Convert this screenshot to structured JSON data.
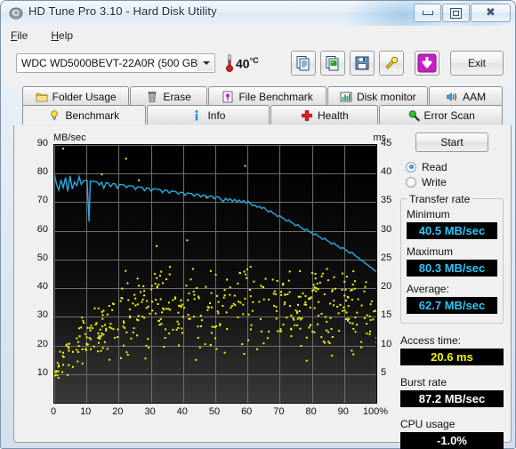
{
  "window": {
    "title": "HD Tune Pro 3.10 - Hard Disk Utility",
    "icon": "hdd-icon",
    "controls": {
      "minimize": "minimize-icon",
      "maximize": "maximize-icon",
      "close": "close-icon"
    }
  },
  "menu": {
    "items": [
      {
        "label": "File",
        "mnemonic": "F"
      },
      {
        "label": "Help",
        "mnemonic": "H"
      }
    ]
  },
  "toolbar": {
    "drive": {
      "selected": "WDC WD5000BEVT-22A0R (500 GB)",
      "options": [
        "WDC WD5000BEVT-22A0R (500 GB)"
      ]
    },
    "temperature": {
      "value": "40",
      "unit": "°C",
      "icon": "thermometer-icon"
    },
    "buttons": [
      {
        "name": "copy-text-button",
        "icon": "copy-document-icon",
        "label": ""
      },
      {
        "name": "copy-image-button",
        "icon": "copy-image-icon",
        "label": ""
      },
      {
        "name": "save-button",
        "icon": "floppy-disk-icon",
        "label": ""
      },
      {
        "name": "options-button",
        "icon": "wrench-icon",
        "label": ""
      },
      {
        "name": "download-button",
        "icon": "down-arrow-icon",
        "label": ""
      }
    ],
    "exit_label": "Exit"
  },
  "tabs": {
    "row1": [
      {
        "label": "Folder Usage",
        "icon": "folder-icon",
        "active": false
      },
      {
        "label": "Erase",
        "icon": "trash-icon",
        "active": false
      },
      {
        "label": "File Benchmark",
        "icon": "file-benchmark-icon",
        "active": false
      },
      {
        "label": "Disk monitor",
        "icon": "bar-chart-icon",
        "active": false
      },
      {
        "label": "AAM",
        "icon": "speaker-icon",
        "active": false
      }
    ],
    "row2": [
      {
        "label": "Benchmark",
        "icon": "lightbulb-icon",
        "active": true
      },
      {
        "label": "Info",
        "icon": "info-icon",
        "active": false
      },
      {
        "label": "Health",
        "icon": "red-cross-icon",
        "active": false
      },
      {
        "label": "Error Scan",
        "icon": "magnifier-icon",
        "active": false
      }
    ]
  },
  "side": {
    "start_label": "Start",
    "mode": {
      "options": [
        {
          "label": "Read",
          "selected": true
        },
        {
          "label": "Write",
          "selected": false
        }
      ]
    },
    "transfer_rate": {
      "title": "Transfer rate",
      "minimum_label": "Minimum",
      "minimum_value": "40.5 MB/sec",
      "maximum_label": "Maximum",
      "maximum_value": "80.3 MB/sec",
      "average_label": "Average:",
      "average_value": "62.7 MB/sec"
    },
    "access_time_label": "Access time:",
    "access_time_value": "20.6 ms",
    "burst_rate_label": "Burst rate",
    "burst_rate_value": "87.2 MB/sec",
    "cpu_usage_label": "CPU usage",
    "cpu_usage_value": "-1.0%"
  },
  "colors": {
    "transfer_line": "#29a9e0",
    "access_dots": "#f5f500",
    "plot_bg": "#000000",
    "grid": "#6e6e6e",
    "stat_cyan": "#2ec5f6",
    "stat_yellow": "#f5f500",
    "stat_white": "#ffffff"
  },
  "chart_data": {
    "type": "line",
    "title": "",
    "xlabel": "",
    "ylabel": "MB/sec",
    "y2label": "ms",
    "xlim": [
      0,
      100
    ],
    "ylim": [
      0,
      90
    ],
    "y2lim": [
      0,
      45
    ],
    "grid": true,
    "legend": "none",
    "xticks": [
      "0",
      "10",
      "20",
      "30",
      "40",
      "50",
      "60",
      "70",
      "80",
      "90",
      "100%"
    ],
    "xtick_values": [
      0,
      10,
      20,
      30,
      40,
      50,
      60,
      70,
      80,
      90,
      100
    ],
    "yticks": [
      10,
      20,
      30,
      40,
      50,
      60,
      70,
      80,
      90
    ],
    "y2ticks": [
      5,
      10,
      15,
      20,
      25,
      30,
      35,
      40,
      45
    ],
    "series": [
      {
        "name": "Transfer rate",
        "axis": "left",
        "units": "MB/sec",
        "color": "#29a9e0",
        "x": [
          0,
          0.7,
          1.4,
          2.1,
          2.8,
          3.5,
          4.2,
          4.9,
          5.6,
          6.3,
          7,
          7.7,
          8.4,
          9.1,
          9.8,
          10.2,
          10.5,
          10.8,
          11.2,
          11.9,
          12.6,
          13.3,
          14,
          14.7,
          15.4,
          16.1,
          16.8,
          17.5,
          18.2,
          18.9,
          19.6,
          20.3,
          21,
          21.7,
          22.4,
          23.1,
          23.8,
          24.5,
          25.2,
          25.9,
          26.6,
          27.3,
          28,
          28.7,
          29.4,
          30.1,
          30.8,
          31.5,
          32.2,
          32.9,
          33.6,
          34.3,
          35,
          35.7,
          36.4,
          37.1,
          37.8,
          38.5,
          39.2,
          39.9,
          40.6,
          41.3,
          42,
          42.7,
          43.4,
          44.1,
          44.8,
          45.5,
          46.2,
          46.9,
          47.6,
          48.3,
          49,
          49.7,
          50.4,
          51.1,
          51.8,
          52.5,
          53.2,
          53.9,
          54.6,
          55.3,
          56,
          56.7,
          57.4,
          58.1,
          58.8,
          59.5,
          60.2,
          60.9,
          61.6,
          62.3,
          63,
          63.7,
          64.4,
          65.1,
          65.8,
          66.5,
          67.2,
          67.9,
          68.6,
          69.3,
          70,
          70.7,
          71.4,
          72.1,
          72.8,
          73.5,
          74.2,
          74.9,
          75.6,
          76.3,
          77,
          77.7,
          78.4,
          79.1,
          79.8,
          80.5,
          81.2,
          81.9,
          82.6,
          83.3,
          84,
          84.7,
          85.4,
          86.1,
          86.8,
          87.5,
          88.2,
          88.9,
          89.6,
          90.3,
          91,
          91.7,
          92.4,
          93.1,
          93.8,
          94.5,
          95.2,
          95.9,
          96.6,
          97.3,
          98,
          98.7,
          99.4,
          100
        ],
        "y": [
          80.0,
          76.4,
          74.2,
          77.8,
          75.1,
          78.6,
          73.8,
          79.2,
          74.6,
          77.1,
          75.8,
          78.9,
          76.2,
          77.5,
          77.6,
          77.6,
          70.5,
          63.2,
          77.4,
          77.3,
          77.2,
          77.1,
          76.0,
          77.0,
          74.9,
          76.8,
          76.7,
          75.4,
          76.5,
          76.4,
          74.8,
          76.2,
          76.1,
          76.0,
          75.1,
          75.8,
          75.7,
          75.6,
          74.4,
          75.4,
          75.3,
          75.2,
          74.0,
          75.0,
          74.9,
          73.9,
          74.7,
          74.6,
          74.5,
          74.4,
          73.3,
          74.2,
          74.1,
          73.2,
          73.9,
          73.8,
          73.7,
          72.8,
          73.5,
          73.4,
          72.4,
          73.2,
          73.1,
          73.0,
          72.1,
          72.8,
          72.7,
          71.8,
          72.5,
          72.4,
          71.5,
          72.2,
          72.1,
          71.2,
          71.9,
          71.8,
          70.9,
          70.2,
          71.4,
          70.6,
          71.2,
          70.3,
          71.0,
          70.1,
          70.8,
          69.9,
          70.6,
          69.7,
          70.4,
          69.5,
          68.8,
          69.0,
          68.2,
          68.6,
          67.8,
          68.2,
          67.4,
          66.6,
          67.0,
          66.2,
          65.8,
          65.0,
          65.4,
          64.6,
          64.2,
          63.4,
          63.8,
          63.0,
          62.6,
          61.8,
          62.2,
          61.4,
          61.0,
          60.2,
          60.6,
          59.8,
          59.4,
          58.6,
          59.0,
          58.2,
          57.8,
          57.0,
          57.4,
          56.6,
          56.2,
          55.4,
          55.8,
          55.0,
          54.6,
          53.8,
          54.2,
          53.4,
          53.0,
          52.2,
          52.6,
          51.8,
          51.0,
          50.6,
          49.8,
          49.4,
          48.6,
          48.2,
          47.4,
          47.0,
          46.2,
          45.8,
          45.0,
          44.0,
          43.0,
          42.4,
          41.8
        ]
      },
      {
        "name": "Access time",
        "axis": "right",
        "units": "ms",
        "color": "#f5f500",
        "type": "scatter",
        "point_count": 470,
        "x_range": [
          0,
          100
        ],
        "y_range_ms": [
          4,
          23
        ],
        "y_range_mbsec_scale": [
          8,
          46
        ],
        "description": "Dense yellow scatter of individual access-time samples rising from ~5 ms near 0% to ~15-22 ms across the disk"
      }
    ]
  }
}
